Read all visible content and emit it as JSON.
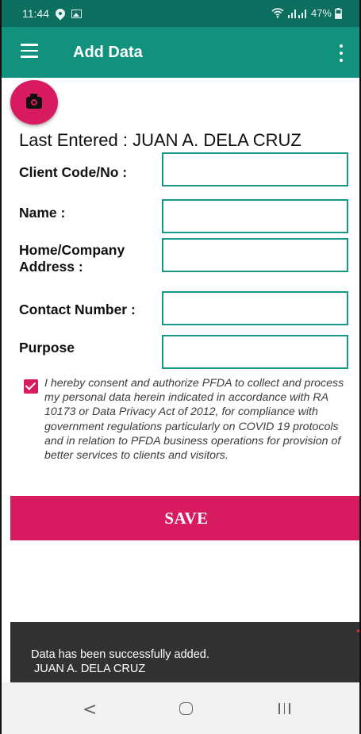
{
  "status_bar": {
    "time": "11:44",
    "battery": "47%",
    "icons": [
      "location-icon",
      "gallery-icon",
      "wifi-icon",
      "signal-icon",
      "battery-icon"
    ]
  },
  "app_bar": {
    "title": "Add Data",
    "menu_icon": "menu-icon",
    "overflow_icon": "more-vert-icon",
    "color": "#12927e"
  },
  "fab": {
    "icon": "camera-icon",
    "color": "#d81b60"
  },
  "last_entered": "Last Entered : JUAN A. DELA CRUZ",
  "form": {
    "client_code": {
      "label": "Client Code/No :",
      "value": ""
    },
    "name": {
      "label": "Name :",
      "value": ""
    },
    "address": {
      "label_line1": "Home/Company",
      "label_line2": "Address :",
      "value": ""
    },
    "contact": {
      "label": "Contact Number :",
      "value": ""
    },
    "purpose": {
      "label": "Purpose",
      "value": ""
    }
  },
  "consent": {
    "checked": true,
    "text": "I hereby consent and authorize PFDA to collect and process my personal data herein indicated in accordance with RA 10173 or Data Privacy Act of 2012, for compliance with government regulations particularly on COVID 19 protocols and in relation to PFDA business operations for provision of better services to clients and visitors."
  },
  "save_button": {
    "label": "SAVE"
  },
  "snackbar": {
    "line1": "Data has been successfully added.",
    "line2": "JUAN A. DELA CRUZ"
  },
  "nav_bar": {
    "back": "<"
  },
  "colors": {
    "primary_dark": "#0b6e5e",
    "primary": "#12927e",
    "accent": "#d81b60",
    "snackbar": "#323232"
  }
}
